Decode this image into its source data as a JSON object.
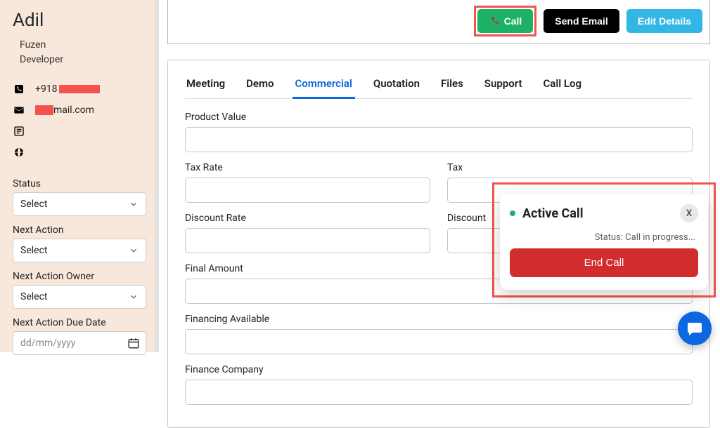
{
  "contact": {
    "name": "Adil",
    "company": "Fuzen",
    "role": "Developer",
    "phone_prefix": "+918",
    "email_suffix": "mail.com"
  },
  "sidebar_fields": {
    "status": {
      "label": "Status",
      "value": "Select"
    },
    "next_action": {
      "label": "Next Action",
      "value": "Select"
    },
    "next_action_owner": {
      "label": "Next Action Owner",
      "value": "Select"
    },
    "next_action_due": {
      "label": "Next Action Due Date",
      "placeholder": "dd/mm/yyyy"
    }
  },
  "topbar": {
    "call_label": "Call",
    "email_label": "Send Email",
    "edit_label": "Edit Details"
  },
  "tabs": [
    {
      "label": "Meeting",
      "active": false
    },
    {
      "label": "Demo",
      "active": false
    },
    {
      "label": "Commercial",
      "active": true
    },
    {
      "label": "Quotation",
      "active": false
    },
    {
      "label": "Files",
      "active": false
    },
    {
      "label": "Support",
      "active": false
    },
    {
      "label": "Call Log",
      "active": false
    }
  ],
  "form": {
    "product_value": {
      "label": "Product Value"
    },
    "tax_rate": {
      "label": "Tax Rate"
    },
    "tax": {
      "label": "Tax"
    },
    "discount_rate": {
      "label": "Discount Rate"
    },
    "discount": {
      "label": "Discount"
    },
    "final_amount": {
      "label": "Final Amount"
    },
    "financing_available": {
      "label": "Financing Available"
    },
    "finance_company": {
      "label": "Finance Company"
    }
  },
  "call_popup": {
    "title": "Active Call",
    "close": "X",
    "status": "Status: Call in progress...",
    "end_call": "End Call"
  }
}
